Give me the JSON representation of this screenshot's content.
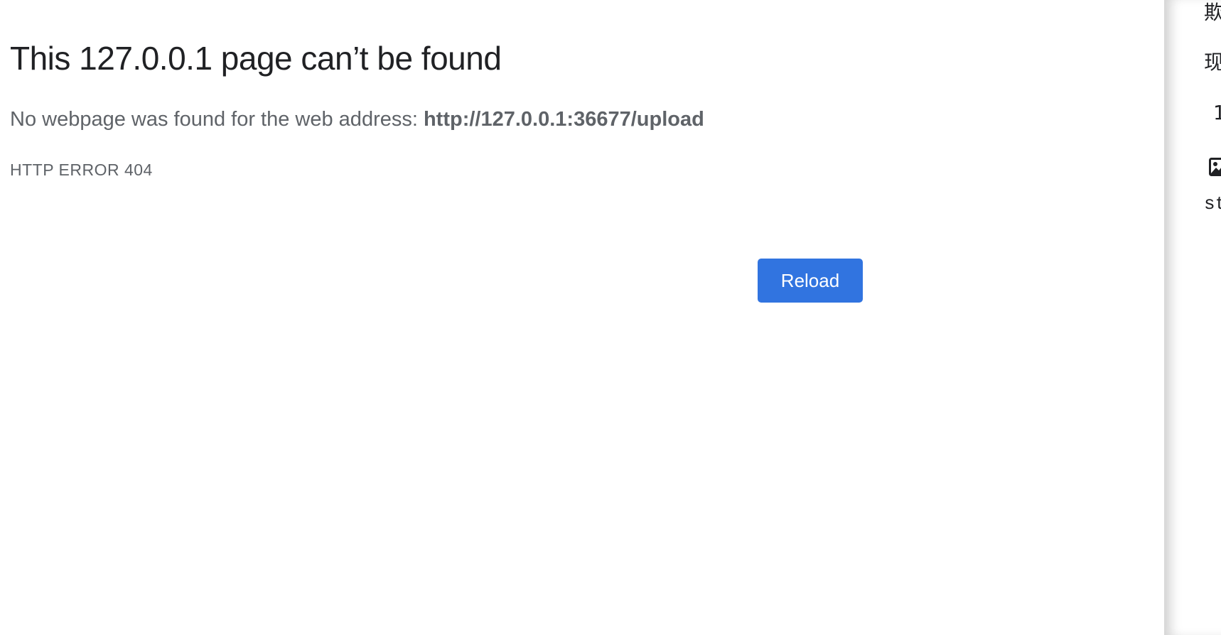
{
  "error_page": {
    "title": "This 127.0.0.1 page can’t be found",
    "message_prefix": "No webpage was found for the web address: ",
    "url": "http://127.0.0.1:36677/upload",
    "error_code": "HTTP ERROR 404",
    "reload_label": "Reload"
  },
  "side_panel": {
    "line1": "欺",
    "line2": "现",
    "line3": "1",
    "line4": "st",
    "image_icon": "image-icon"
  },
  "colors": {
    "button": "#3174e0",
    "title": "#202124",
    "body_text": "#5f6368"
  }
}
